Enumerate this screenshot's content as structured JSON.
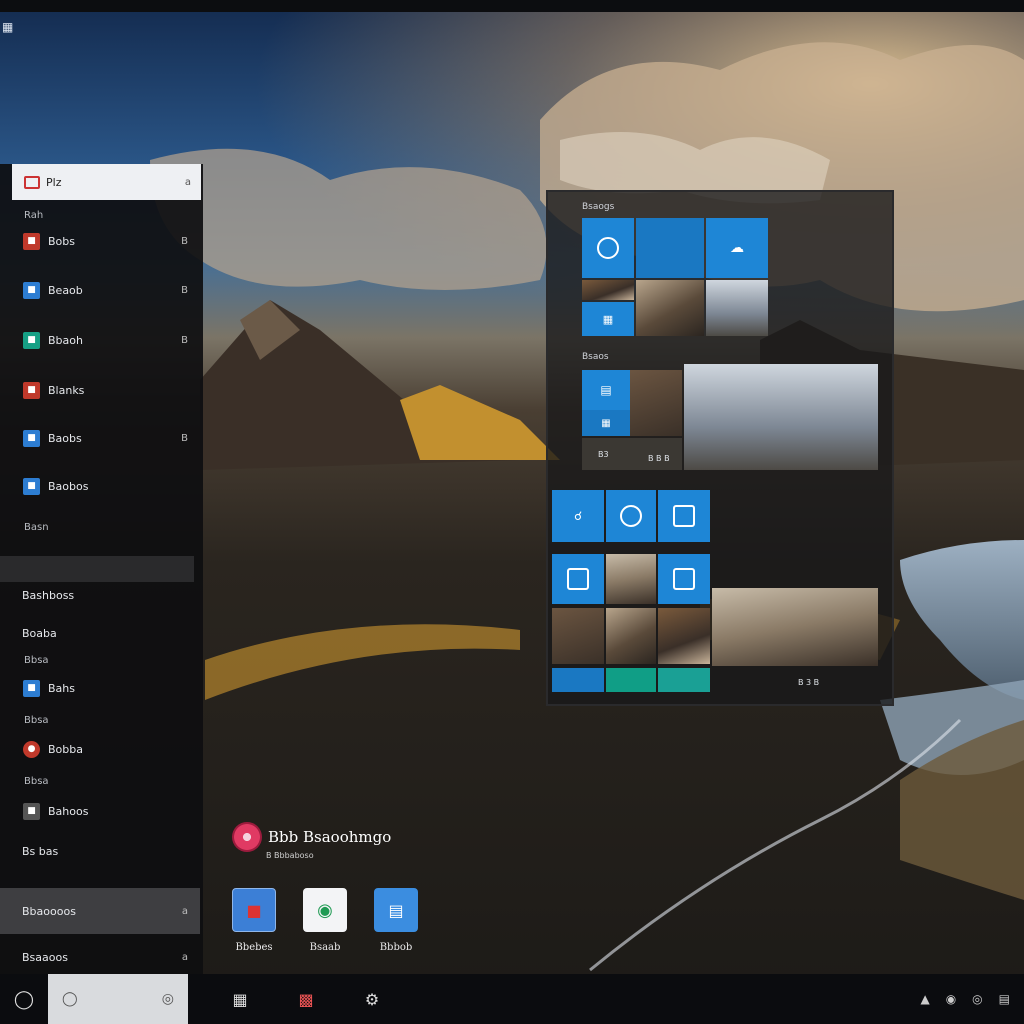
{
  "top_corner_icon": "window-icon",
  "start_menu": {
    "search": {
      "label": "Plz",
      "trailing": "a"
    },
    "group_label": "Rah",
    "items": [
      {
        "label": "Bobs",
        "trailing": "B",
        "icon": "app-icon-1",
        "color": "#c0392b"
      },
      {
        "label": "Beaob",
        "trailing": "B",
        "icon": "app-icon-2",
        "color": "#2d7dd2"
      },
      {
        "label": "Bbaoh",
        "trailing": "B",
        "icon": "app-icon-3",
        "color": "#16a085"
      },
      {
        "label": "Blanks",
        "trailing": "",
        "icon": "app-icon-4",
        "color": "#c0392b"
      },
      {
        "label": "Baobs",
        "trailing": "B",
        "icon": "app-icon-5",
        "color": "#2d7dd2"
      },
      {
        "label": "Baobos",
        "trailing": "",
        "icon": "app-icon-6",
        "color": "#2d7dd2"
      }
    ],
    "section_label": "Basn",
    "section_item": "Bashboss",
    "plain_item": "Boaba",
    "small_label_1": "Bbsa",
    "item_b": "Bahs",
    "small_label_2": "Bbsa",
    "item_c": "Bobba",
    "small_label_3": "Bbsa",
    "item_d": "Bahoos",
    "item_e": "Bs bas",
    "highlight_item": {
      "label": "Bbaoooos",
      "trailing": "a"
    },
    "bottom_item": {
      "label": "Bsaaoos",
      "trailing": "a"
    }
  },
  "tile_panel": {
    "header_1": "Bsaogs",
    "header_2": "Bsaos",
    "footer_left": "B3",
    "footer_mid": "B B B",
    "footer_right": "B 3 B"
  },
  "desktop": {
    "title": "Bbb Bsaoohmgo",
    "subtitle": "B Bbbaboso",
    "icons": [
      {
        "label": "Bbebes",
        "icon": "photo-app-icon"
      },
      {
        "label": "Bsaab",
        "icon": "settings-app-icon"
      },
      {
        "label": "Bbbob",
        "icon": "document-app-icon"
      }
    ]
  },
  "taskbar": {
    "apps": [
      "window-icon",
      "calendar-icon",
      "gear-icon"
    ]
  },
  "colors": {
    "accent": "#1e86d6",
    "menu_bg": "#0e0e10",
    "taskbar_bg": "#0b0c0f"
  }
}
